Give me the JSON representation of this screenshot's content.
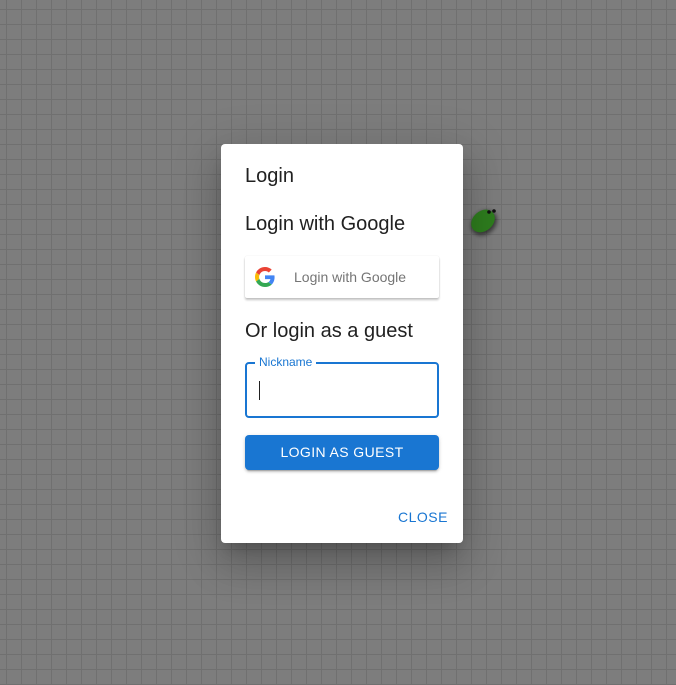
{
  "dialog": {
    "title": "Login",
    "google_heading": "Login with Google",
    "google_button_label": "Login with Google",
    "guest_heading": "Or login as a guest",
    "nickname_label": "Nickname",
    "nickname_value": "",
    "guest_button_label": "LOGIN AS GUEST",
    "close_button_label": "CLOSE"
  },
  "icons": {
    "google": "google-g-icon",
    "snake": "snake-player"
  },
  "colors": {
    "primary": "#1976d2",
    "background": "#7d7d7d",
    "grid": "#707070",
    "snake_body": "#2e7d1e",
    "dialog_bg": "#ffffff"
  }
}
